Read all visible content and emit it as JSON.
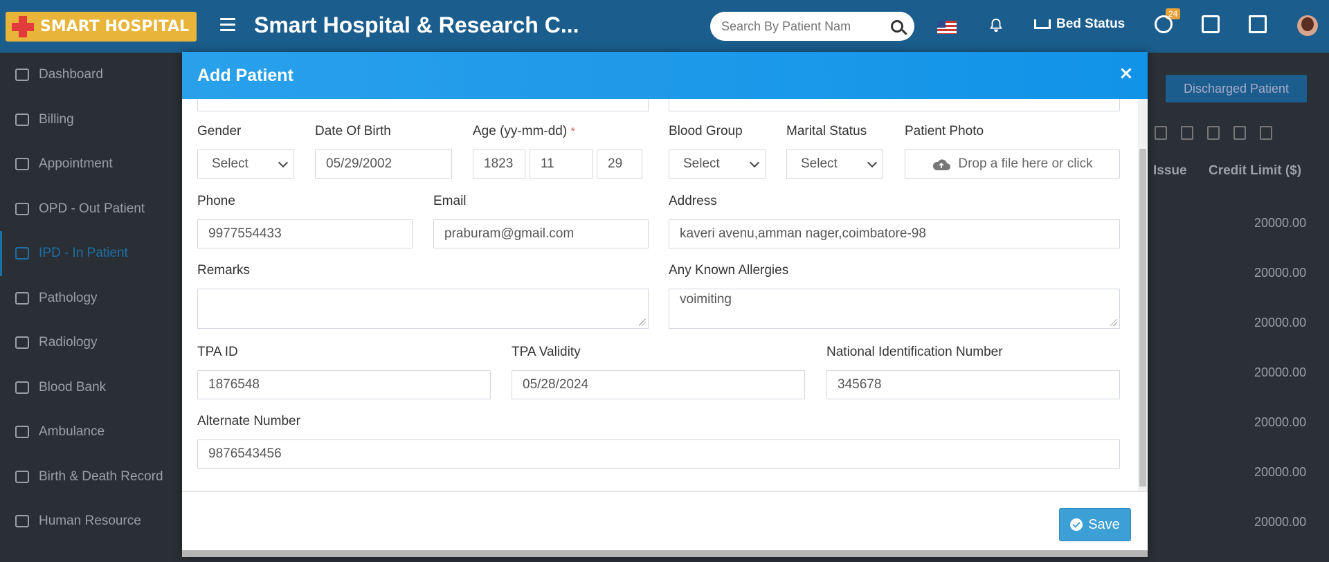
{
  "app": {
    "logo_text": "SMART HOSPITAL",
    "title": "Smart Hospital & Research C...",
    "search_placeholder": "Search By Patient Nam",
    "bed_status": "Bed Status",
    "notification_badge": "24"
  },
  "sidebar": {
    "items": [
      {
        "label": "Dashboard",
        "icon": "monitor-icon"
      },
      {
        "label": "Billing",
        "icon": "receipt-icon"
      },
      {
        "label": "Appointment",
        "icon": "calendar-check-icon"
      },
      {
        "label": "OPD - Out Patient",
        "icon": "stethoscope-icon"
      },
      {
        "label": "IPD - In Patient",
        "icon": "bed-icon",
        "active": true
      },
      {
        "label": "Pathology",
        "icon": "flask-icon"
      },
      {
        "label": "Radiology",
        "icon": "microscope-icon"
      },
      {
        "label": "Blood Bank",
        "icon": "droplet-icon"
      },
      {
        "label": "Ambulance",
        "icon": "ambulance-icon"
      },
      {
        "label": "Birth & Death Record",
        "icon": "family-icon"
      },
      {
        "label": "Human Resource",
        "icon": "sitemap-icon"
      }
    ]
  },
  "background": {
    "discharged_button": "Discharged Patient",
    "col_issue": "Issue",
    "col_credit_limit": "Credit Limit ($)",
    "credit_values": [
      "20000.00",
      "20000.00",
      "20000.00",
      "20000.00",
      "20000.00",
      "20000.00",
      "20000.00"
    ]
  },
  "modal": {
    "title": "Add Patient",
    "close": "×",
    "fields": {
      "gender": {
        "label": "Gender",
        "value": "Select"
      },
      "dob": {
        "label": "Date Of Birth",
        "value": "05/29/2002"
      },
      "age": {
        "label": "Age (yy-mm-dd)",
        "required": "*",
        "yy": "1823",
        "mm": "11",
        "dd": "29"
      },
      "blood_group": {
        "label": "Blood Group",
        "value": "Select"
      },
      "marital_status": {
        "label": "Marital Status",
        "value": "Select"
      },
      "patient_photo": {
        "label": "Patient Photo",
        "value": "Drop a file here or click"
      },
      "phone": {
        "label": "Phone",
        "value": "9977554433"
      },
      "email": {
        "label": "Email",
        "value": "praburam@gmail.com"
      },
      "address": {
        "label": "Address",
        "value": "kaveri avenu,amman nager,coimbatore-98"
      },
      "remarks": {
        "label": "Remarks",
        "value": ""
      },
      "allergies": {
        "label": "Any Known Allergies",
        "value": "voimiting"
      },
      "tpa_id": {
        "label": "TPA ID",
        "value": "1876548"
      },
      "tpa_validity": {
        "label": "TPA Validity",
        "value": "05/28/2024"
      },
      "national_id": {
        "label": "National Identification Number",
        "value": "345678"
      },
      "alternate_number": {
        "label": "Alternate Number",
        "value": "9876543456"
      }
    },
    "save_label": "Save"
  },
  "colors": {
    "header_blue": "#1b5d8c",
    "modal_header": "#1193e8",
    "save_button": "#3c9fd6",
    "required": "#d9534f"
  }
}
